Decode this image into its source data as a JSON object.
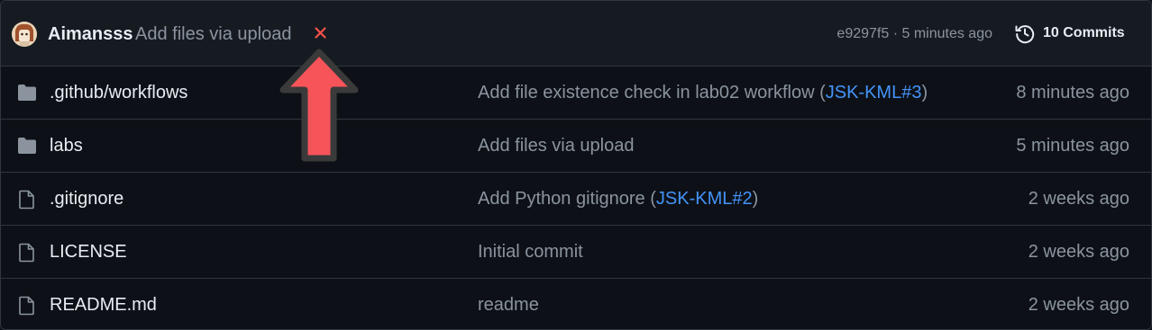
{
  "latest_commit": {
    "author": "Aimansss",
    "message": "Add files via upload",
    "status_icon": "x-icon",
    "status_color": "#f85149",
    "hash": "e9297f5",
    "separator": " · ",
    "time": "5 minutes ago",
    "commits_label": "10 Commits",
    "commits_icon": "history-icon"
  },
  "files": [
    {
      "type": "folder",
      "icon": "folder-icon",
      "name": ".github/workflows",
      "message_before": "Add file existence check in lab02 workflow (",
      "message_link": "JSK-KML#3",
      "message_after": ")",
      "age": "8 minutes ago"
    },
    {
      "type": "folder",
      "icon": "folder-icon",
      "name": "labs",
      "message_before": "Add files via upload",
      "message_link": "",
      "message_after": "",
      "age": "5 minutes ago"
    },
    {
      "type": "file",
      "icon": "file-icon",
      "name": ".gitignore",
      "message_before": "Add Python gitignore (",
      "message_link": "JSK-KML#2",
      "message_after": ")",
      "age": "2 weeks ago"
    },
    {
      "type": "file",
      "icon": "file-icon",
      "name": "LICENSE",
      "message_before": "Initial commit",
      "message_link": "",
      "message_after": "",
      "age": "2 weeks ago"
    },
    {
      "type": "file",
      "icon": "file-icon",
      "name": "README.md",
      "message_before": "readme",
      "message_link": "",
      "message_after": "",
      "age": "2 weeks ago"
    }
  ],
  "colors": {
    "background": "#0d1117",
    "header_background": "#161b22",
    "border": "#30363d",
    "text_primary": "#e6edf3",
    "text_muted": "#8b949e",
    "link": "#4493f8",
    "annotation_arrow": "#f7545a"
  },
  "annotation": {
    "icon": "up-arrow-annotation"
  }
}
